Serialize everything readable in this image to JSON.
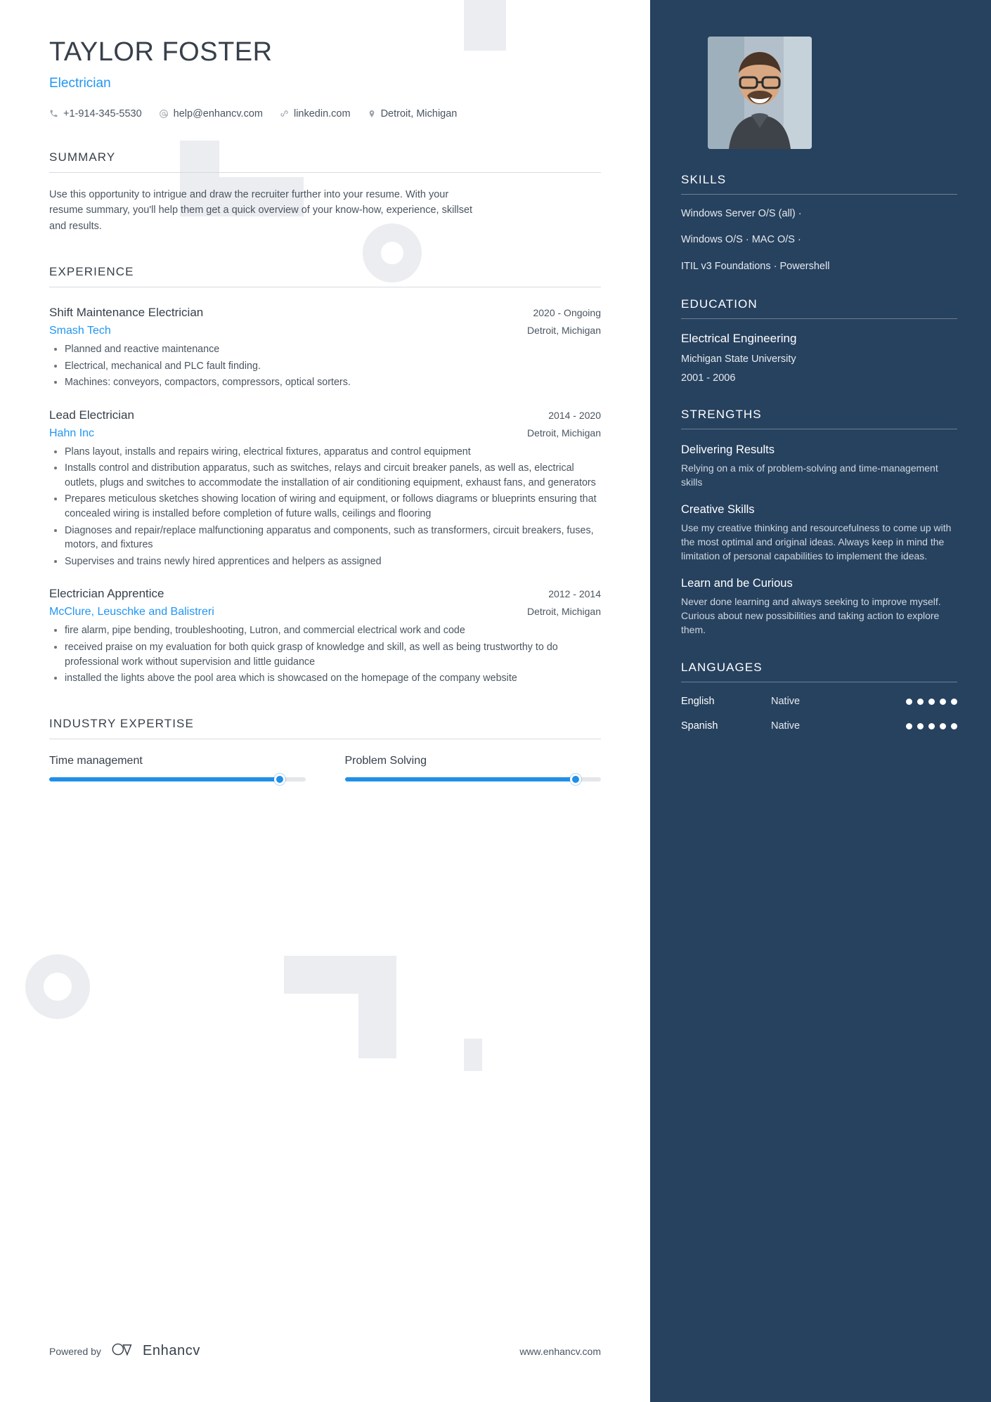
{
  "colors": {
    "accent": "#2196f3",
    "sidebar_bg": "#27425f",
    "text": "#37404a",
    "slider": "#1f8fe8"
  },
  "header": {
    "name": "TAYLOR FOSTER",
    "role": "Electrician",
    "contacts": [
      {
        "icon": "phone-icon",
        "text": "+1-914-345-5530"
      },
      {
        "icon": "email-icon",
        "text": "help@enhancv.com"
      },
      {
        "icon": "link-icon",
        "text": "linkedin.com"
      },
      {
        "icon": "location-pin-icon",
        "text": "Detroit, Michigan"
      }
    ]
  },
  "summary": {
    "title": "SUMMARY",
    "text": "Use this opportunity to intrigue and draw the recruiter further into your resume. With your resume summary, you'll help them get a quick overview of your know-how, experience, skillset and results."
  },
  "experience": {
    "title": "EXPERIENCE",
    "jobs": [
      {
        "title": "Shift Maintenance Electrician",
        "company": "Smash Tech",
        "date": "2020 - Ongoing",
        "location": "Detroit, Michigan",
        "bullets": [
          "Planned and reactive maintenance",
          "Electrical, mechanical and PLC fault finding.",
          "Machines: conveyors, compactors, compressors, optical sorters."
        ]
      },
      {
        "title": "Lead Electrician",
        "company": "Hahn Inc",
        "date": "2014 - 2020",
        "location": "Detroit, Michigan",
        "bullets": [
          "Plans layout, installs and repairs wiring, electrical fixtures, apparatus and control equipment",
          "Installs control and distribution apparatus, such as switches, relays and circuit breaker panels, as well as, electrical outlets, plugs and switches to accommodate the installation of air conditioning equipment, exhaust fans, and generators",
          "Prepares meticulous sketches showing location of wiring and equipment, or follows diagrams or blueprints ensuring that concealed wiring is installed before completion of future walls, ceilings and flooring",
          "Diagnoses and repair/replace malfunctioning apparatus and components, such as transformers, circuit breakers, fuses, motors, and fixtures",
          "Supervises and trains newly hired apprentices and helpers as assigned"
        ]
      },
      {
        "title": "Electrician Apprentice",
        "company": "McClure, Leuschke and Balistreri",
        "date": "2012 - 2014",
        "location": "Detroit, Michigan",
        "bullets": [
          "fire alarm, pipe bending, troubleshooting, Lutron, and commercial electrical work and code",
          "received praise on my evaluation for both quick grasp of knowledge and skill, as well as being trustworthy to do professional work without supervision and little guidance",
          "installed the lights above the pool area which is showcased on the homepage of the company website"
        ]
      }
    ]
  },
  "industry_expertise": {
    "title": "INDUSTRY EXPERTISE",
    "items": [
      {
        "label": "Time management",
        "value": 90
      },
      {
        "label": "Problem Solving",
        "value": 90
      }
    ]
  },
  "sidebar": {
    "skills": {
      "title": "SKILLS",
      "lines": [
        "Windows Server O/S (all) ·",
        "Windows O/S · MAC O/S ·",
        "ITIL v3 Foundations · Powershell"
      ]
    },
    "education": {
      "title": "EDUCATION",
      "degree": "Electrical Engineering",
      "school": "Michigan State University",
      "date": "2001 - 2006"
    },
    "strengths": {
      "title": "STRENGTHS",
      "items": [
        {
          "name": "Delivering Results",
          "desc": "Relying on a mix of problem-solving and time-management skills"
        },
        {
          "name": "Creative Skills",
          "desc": "Use my creative thinking and resourcefulness to come up with the most optimal and original ideas. Always keep in mind the limitation of personal capabilities to implement the ideas."
        },
        {
          "name": "Learn and be Curious",
          "desc": "Never done learning and always seeking to improve myself. Curious about new possibilities and taking action to explore them."
        }
      ]
    },
    "languages": {
      "title": "LANGUAGES",
      "items": [
        {
          "name": "English",
          "level": "Native",
          "dots": 5,
          "total": 5
        },
        {
          "name": "Spanish",
          "level": "Native",
          "dots": 5,
          "total": 5
        }
      ]
    }
  },
  "footer": {
    "powered_by": "Powered by",
    "brand": "Enhancv",
    "site": "www.enhancv.com"
  }
}
